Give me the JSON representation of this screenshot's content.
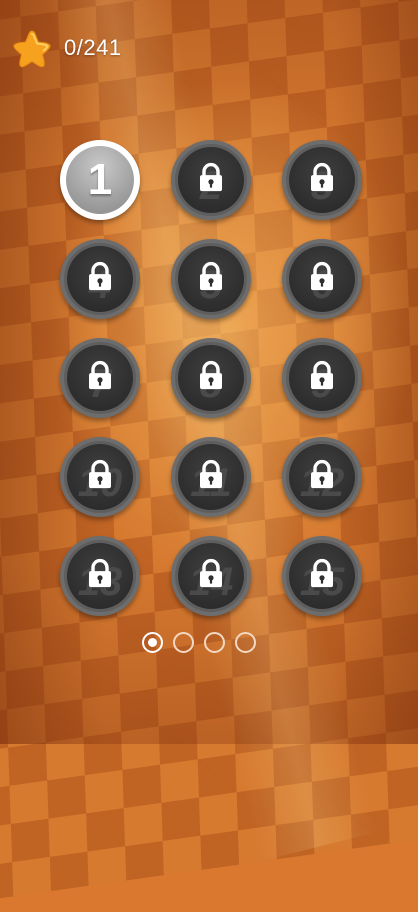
{
  "header": {
    "star_icon": "star-icon",
    "score": "0/241"
  },
  "levels": [
    {
      "number": "1",
      "locked": false
    },
    {
      "number": "2",
      "locked": true
    },
    {
      "number": "3",
      "locked": true
    },
    {
      "number": "4",
      "locked": true
    },
    {
      "number": "5",
      "locked": true
    },
    {
      "number": "6",
      "locked": true
    },
    {
      "number": "7",
      "locked": true
    },
    {
      "number": "8",
      "locked": true
    },
    {
      "number": "9",
      "locked": true
    },
    {
      "number": "10",
      "locked": true
    },
    {
      "number": "11",
      "locked": true
    },
    {
      "number": "12",
      "locked": true
    },
    {
      "number": "13",
      "locked": true
    },
    {
      "number": "14",
      "locked": true
    },
    {
      "number": "15",
      "locked": true
    }
  ],
  "pager": {
    "pages": 4,
    "current": 1
  },
  "colors": {
    "background": "#d67a30",
    "locked_button": "#2c2c2c",
    "unlocked_button": "#9a9a9a",
    "star": "#f9a823"
  }
}
